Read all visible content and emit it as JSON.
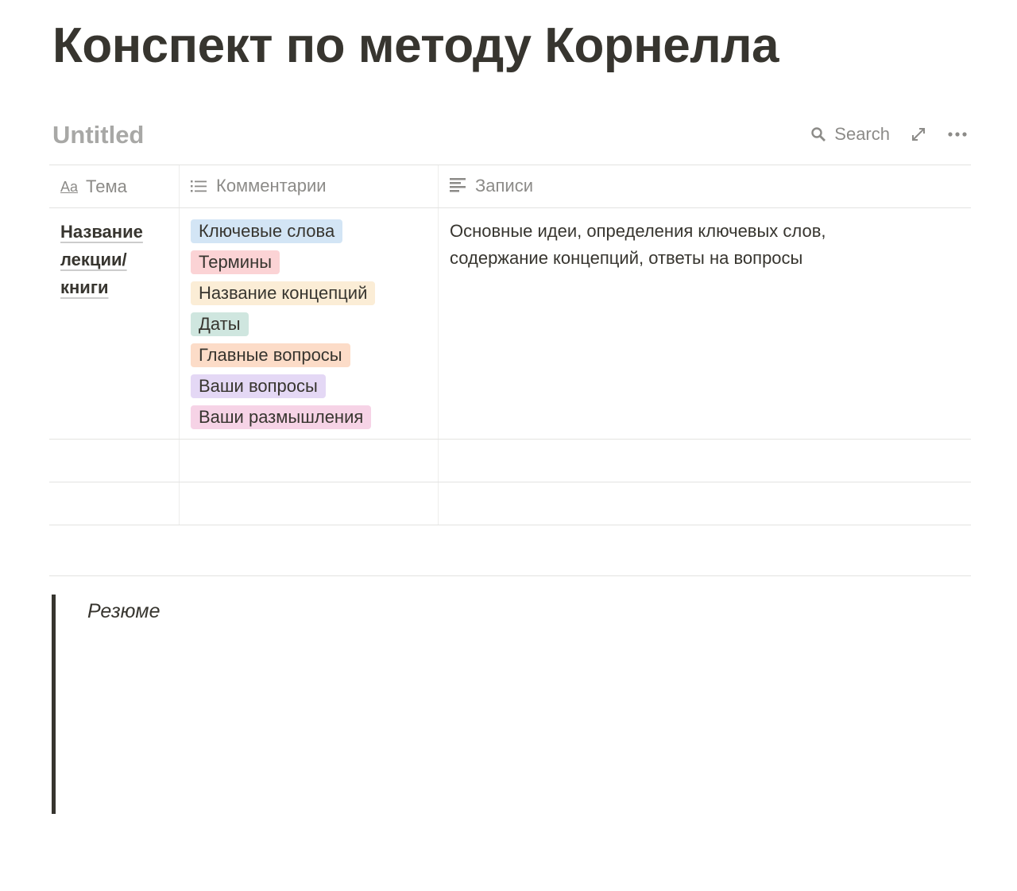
{
  "page_title": "Конспект по методу Корнелла",
  "database": {
    "title": "Untitled",
    "search_label": "Search"
  },
  "columns": [
    {
      "label": "Тема",
      "icon": "text-aa-icon"
    },
    {
      "label": "Комментарии",
      "icon": "list-icon"
    },
    {
      "label": "Записи",
      "icon": "paragraph-icon"
    }
  ],
  "rows": [
    {
      "topic": "Название лекции/ книги",
      "tags": [
        {
          "label": "Ключевые слова",
          "color": "#d3e5f5"
        },
        {
          "label": "Термины",
          "color": "#fbd3d5"
        },
        {
          "label": "Название концепций",
          "color": "#fbedd6"
        },
        {
          "label": "Даты",
          "color": "#cfe6df"
        },
        {
          "label": "Главные вопросы",
          "color": "#fcdcc8"
        },
        {
          "label": "Ваши вопросы",
          "color": "#e4d8f5"
        },
        {
          "label": "Ваши размышления",
          "color": "#f6d3e6"
        }
      ],
      "notes": "Основные идеи, определения ключевых слов, содержание концепций, ответы на вопросы"
    }
  ],
  "summary": {
    "label": "Резюме"
  }
}
